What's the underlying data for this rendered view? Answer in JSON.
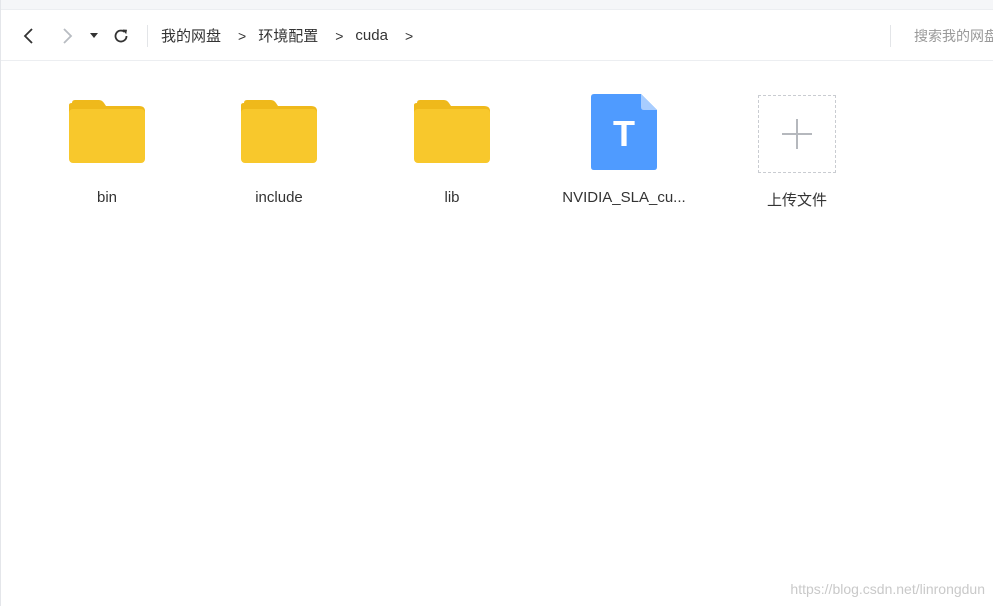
{
  "toolbar": {
    "breadcrumb": [
      {
        "label": "我的网盘"
      },
      {
        "label": "环境配置"
      },
      {
        "label": "cuda"
      }
    ],
    "separator": ">",
    "search": {
      "placeholder": "搜索我的网盘",
      "value": ""
    }
  },
  "items": [
    {
      "name": "bin",
      "type": "folder",
      "icon": "folder-icon"
    },
    {
      "name": "include",
      "type": "folder",
      "icon": "folder-icon"
    },
    {
      "name": "lib",
      "type": "folder",
      "icon": "folder-icon"
    },
    {
      "name": "NVIDIA_SLA_cu...",
      "type": "file",
      "icon": "text-file-icon",
      "glyph": "T"
    },
    {
      "name": "上传文件",
      "type": "upload",
      "icon": "plus-icon"
    }
  ],
  "watermark": "https://blog.csdn.net/linrongdun",
  "colors": {
    "folder": "#f8c82c",
    "folder_tab": "#efb91b",
    "file": "#4f9bff",
    "file_fold": "#a8cdff",
    "text": "#333333"
  }
}
